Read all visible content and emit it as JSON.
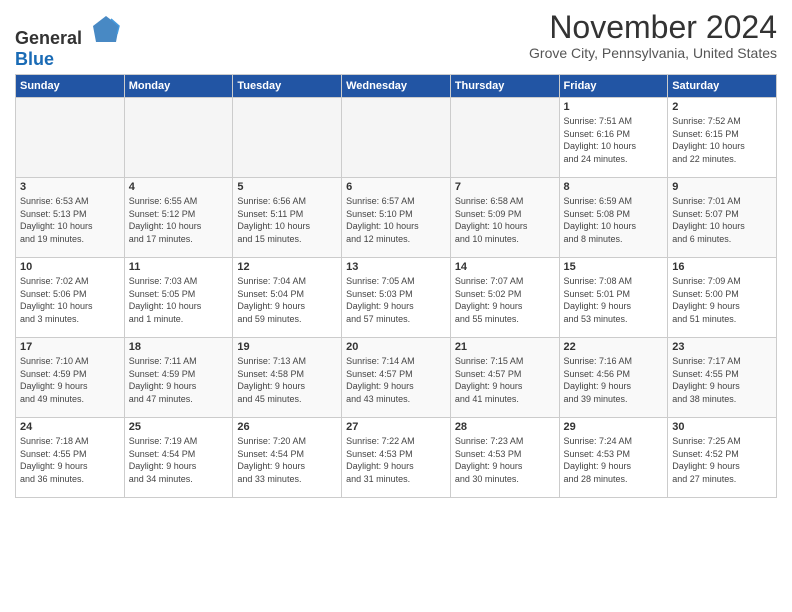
{
  "logo": {
    "general": "General",
    "blue": "Blue"
  },
  "title": "November 2024",
  "subtitle": "Grove City, Pennsylvania, United States",
  "headers": [
    "Sunday",
    "Monday",
    "Tuesday",
    "Wednesday",
    "Thursday",
    "Friday",
    "Saturday"
  ],
  "weeks": [
    [
      {
        "day": "",
        "info": ""
      },
      {
        "day": "",
        "info": ""
      },
      {
        "day": "",
        "info": ""
      },
      {
        "day": "",
        "info": ""
      },
      {
        "day": "",
        "info": ""
      },
      {
        "day": "1",
        "info": "Sunrise: 7:51 AM\nSunset: 6:16 PM\nDaylight: 10 hours\nand 24 minutes."
      },
      {
        "day": "2",
        "info": "Sunrise: 7:52 AM\nSunset: 6:15 PM\nDaylight: 10 hours\nand 22 minutes."
      }
    ],
    [
      {
        "day": "3",
        "info": "Sunrise: 6:53 AM\nSunset: 5:13 PM\nDaylight: 10 hours\nand 19 minutes."
      },
      {
        "day": "4",
        "info": "Sunrise: 6:55 AM\nSunset: 5:12 PM\nDaylight: 10 hours\nand 17 minutes."
      },
      {
        "day": "5",
        "info": "Sunrise: 6:56 AM\nSunset: 5:11 PM\nDaylight: 10 hours\nand 15 minutes."
      },
      {
        "day": "6",
        "info": "Sunrise: 6:57 AM\nSunset: 5:10 PM\nDaylight: 10 hours\nand 12 minutes."
      },
      {
        "day": "7",
        "info": "Sunrise: 6:58 AM\nSunset: 5:09 PM\nDaylight: 10 hours\nand 10 minutes."
      },
      {
        "day": "8",
        "info": "Sunrise: 6:59 AM\nSunset: 5:08 PM\nDaylight: 10 hours\nand 8 minutes."
      },
      {
        "day": "9",
        "info": "Sunrise: 7:01 AM\nSunset: 5:07 PM\nDaylight: 10 hours\nand 6 minutes."
      }
    ],
    [
      {
        "day": "10",
        "info": "Sunrise: 7:02 AM\nSunset: 5:06 PM\nDaylight: 10 hours\nand 3 minutes."
      },
      {
        "day": "11",
        "info": "Sunrise: 7:03 AM\nSunset: 5:05 PM\nDaylight: 10 hours\nand 1 minute."
      },
      {
        "day": "12",
        "info": "Sunrise: 7:04 AM\nSunset: 5:04 PM\nDaylight: 9 hours\nand 59 minutes."
      },
      {
        "day": "13",
        "info": "Sunrise: 7:05 AM\nSunset: 5:03 PM\nDaylight: 9 hours\nand 57 minutes."
      },
      {
        "day": "14",
        "info": "Sunrise: 7:07 AM\nSunset: 5:02 PM\nDaylight: 9 hours\nand 55 minutes."
      },
      {
        "day": "15",
        "info": "Sunrise: 7:08 AM\nSunset: 5:01 PM\nDaylight: 9 hours\nand 53 minutes."
      },
      {
        "day": "16",
        "info": "Sunrise: 7:09 AM\nSunset: 5:00 PM\nDaylight: 9 hours\nand 51 minutes."
      }
    ],
    [
      {
        "day": "17",
        "info": "Sunrise: 7:10 AM\nSunset: 4:59 PM\nDaylight: 9 hours\nand 49 minutes."
      },
      {
        "day": "18",
        "info": "Sunrise: 7:11 AM\nSunset: 4:59 PM\nDaylight: 9 hours\nand 47 minutes."
      },
      {
        "day": "19",
        "info": "Sunrise: 7:13 AM\nSunset: 4:58 PM\nDaylight: 9 hours\nand 45 minutes."
      },
      {
        "day": "20",
        "info": "Sunrise: 7:14 AM\nSunset: 4:57 PM\nDaylight: 9 hours\nand 43 minutes."
      },
      {
        "day": "21",
        "info": "Sunrise: 7:15 AM\nSunset: 4:57 PM\nDaylight: 9 hours\nand 41 minutes."
      },
      {
        "day": "22",
        "info": "Sunrise: 7:16 AM\nSunset: 4:56 PM\nDaylight: 9 hours\nand 39 minutes."
      },
      {
        "day": "23",
        "info": "Sunrise: 7:17 AM\nSunset: 4:55 PM\nDaylight: 9 hours\nand 38 minutes."
      }
    ],
    [
      {
        "day": "24",
        "info": "Sunrise: 7:18 AM\nSunset: 4:55 PM\nDaylight: 9 hours\nand 36 minutes."
      },
      {
        "day": "25",
        "info": "Sunrise: 7:19 AM\nSunset: 4:54 PM\nDaylight: 9 hours\nand 34 minutes."
      },
      {
        "day": "26",
        "info": "Sunrise: 7:20 AM\nSunset: 4:54 PM\nDaylight: 9 hours\nand 33 minutes."
      },
      {
        "day": "27",
        "info": "Sunrise: 7:22 AM\nSunset: 4:53 PM\nDaylight: 9 hours\nand 31 minutes."
      },
      {
        "day": "28",
        "info": "Sunrise: 7:23 AM\nSunset: 4:53 PM\nDaylight: 9 hours\nand 30 minutes."
      },
      {
        "day": "29",
        "info": "Sunrise: 7:24 AM\nSunset: 4:53 PM\nDaylight: 9 hours\nand 28 minutes."
      },
      {
        "day": "30",
        "info": "Sunrise: 7:25 AM\nSunset: 4:52 PM\nDaylight: 9 hours\nand 27 minutes."
      }
    ]
  ]
}
